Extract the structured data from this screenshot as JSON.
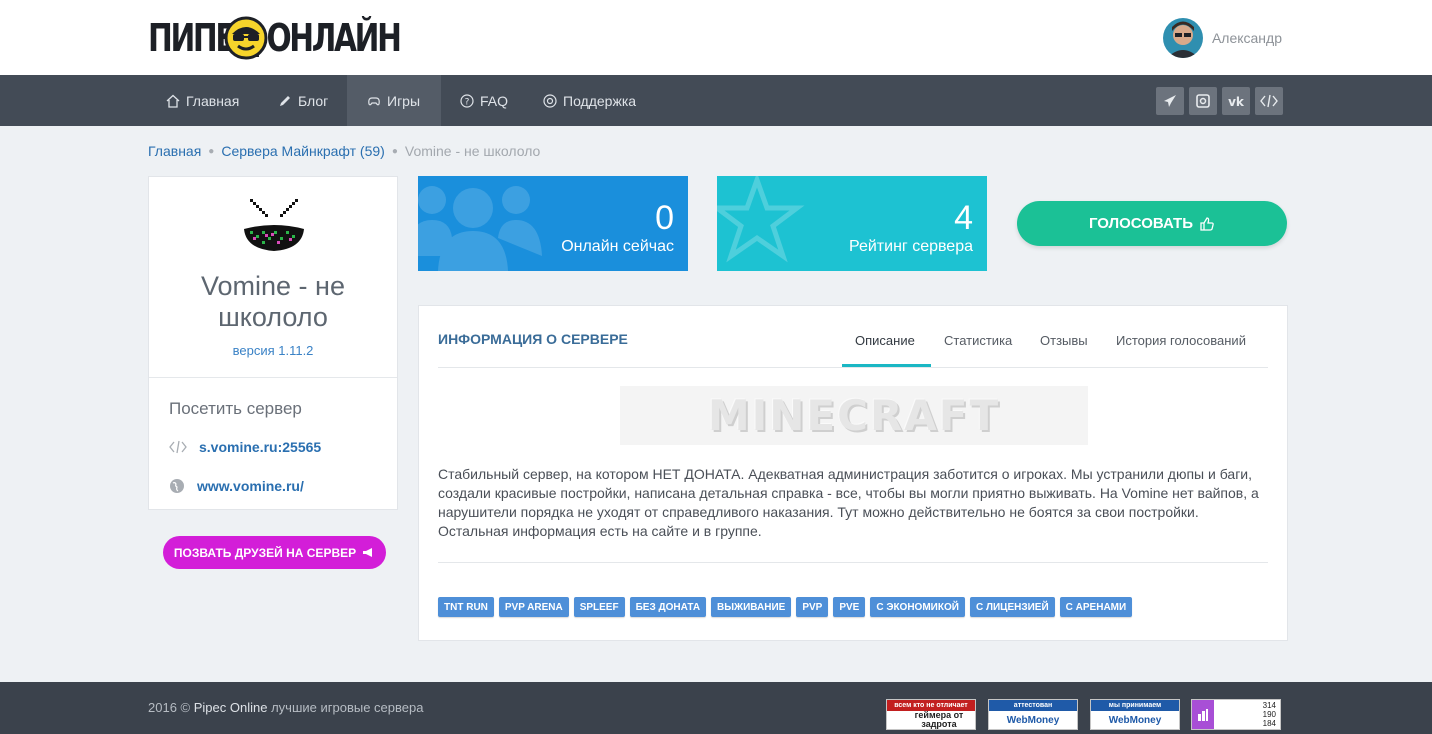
{
  "header": {
    "logo_text": "ПИПЕЦ ОНЛАЙН",
    "user_name": "Александр"
  },
  "nav": {
    "items": [
      {
        "label": "Главная",
        "icon": "home-icon"
      },
      {
        "label": "Блог",
        "icon": "pencil-icon"
      },
      {
        "label": "Игры",
        "icon": "gamepad-icon",
        "active": true
      },
      {
        "label": "FAQ",
        "icon": "question-circle-icon"
      },
      {
        "label": "Поддержка",
        "icon": "lifebuoy-icon"
      }
    ],
    "social": [
      "telegram-icon",
      "instagram-icon",
      "vk-icon",
      "code-icon"
    ]
  },
  "breadcrumb": {
    "home": "Главная",
    "category": "Сервера Майнкрафт (59)",
    "current": "Vomine - не школоло"
  },
  "server": {
    "name": "Vomine - не школоло",
    "version": "версия 1.11.2",
    "visit_title": "Посетить сервер",
    "address": "s.vomine.ru:25565",
    "website": "www.vomine.ru/",
    "invite_button": "ПОЗВАТЬ ДРУЗЕЙ НА СЕРВЕР"
  },
  "stats": {
    "online_value": "0",
    "online_label": "Онлайн сейчас",
    "rating_value": "4",
    "rating_label": "Рейтинг сервера",
    "vote_button": "ГОЛОСОВАТЬ"
  },
  "info": {
    "title": "ИНФОРМАЦИЯ О СЕРВЕРЕ",
    "tabs": [
      "Описание",
      "Статистика",
      "Отзывы",
      "История голосований"
    ],
    "active_tab": "Описание",
    "banner_text": "MINECRAFT",
    "description": "Стабильный сервер, на котором НЕТ ДОНАТА. Адекватная администрация заботится о игроках. Мы устранили дюпы и баги, создали красивые постройки, написана детальная справка - все, чтобы вы могли приятно выживать. На Vomine нет вайпов, а нарушители порядка не уходят от справедливого наказания. Тут можно действительно не боятся за свои постройки. Остальная информация есть на сайте и в группе.",
    "tags": [
      "TNT RUN",
      "PVP ARENA",
      "SPLEEF",
      "БЕЗ ДОНАТА",
      "ВЫЖИВАНИЕ",
      "PVP",
      "PVE",
      "С ЭКОНОМИКОЙ",
      "С ЛИЦЕНЗИЕЙ",
      "С АРЕНАМИ"
    ]
  },
  "footer": {
    "copyright": "2016 ©",
    "brand": "Pipec Online",
    "tagline": "лучшие игровые сервера",
    "badge1_top": "всем кто не отличает",
    "badge1_bottom": "геймера от задрота",
    "badge2_top": "аттестован",
    "badge2_bottom": "WebMoney",
    "badge3_top": "мы принимаем",
    "badge3_bottom": "WebMoney",
    "counter": [
      "314",
      "190",
      "184"
    ]
  },
  "colors": {
    "nav_bg": "#434b56",
    "online_box": "#1a8fdc",
    "rating_box": "#1dc2d2",
    "vote_button": "#1bc196",
    "invite_button": "#d31ed8",
    "tag": "#4e8fd8"
  }
}
